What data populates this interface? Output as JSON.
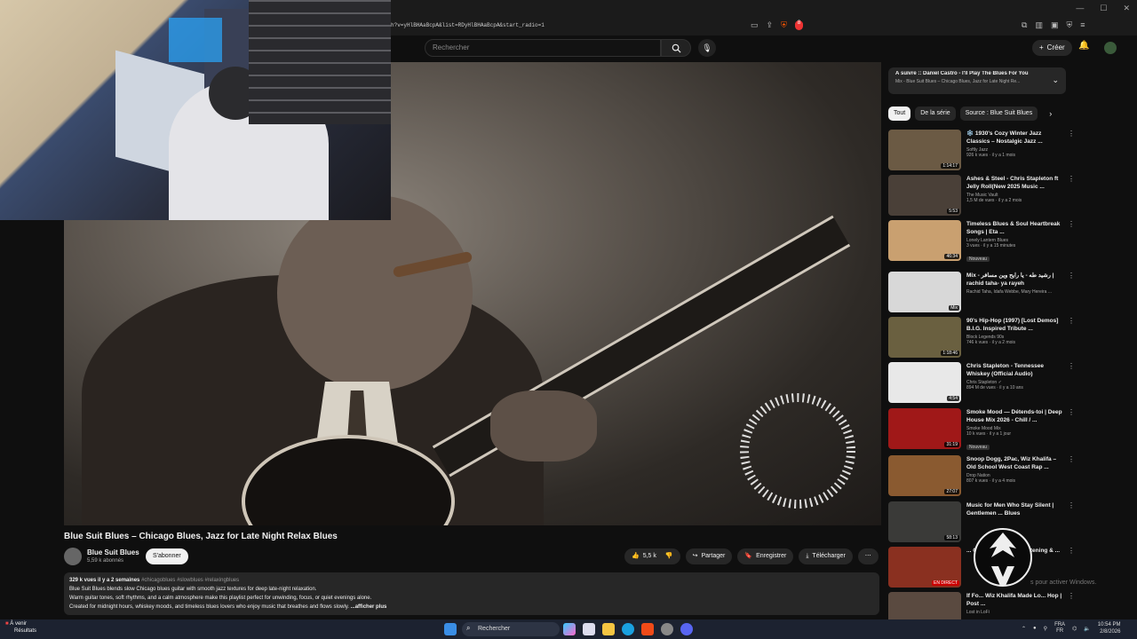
{
  "browser": {
    "url": "h?v=yHlBHAaBcpA&list=RDyHlBHAaBcpA&start_radio=1",
    "notif_count": "8"
  },
  "header": {
    "search_placeholder": "Rechercher",
    "create_label": "Créer",
    "bell_count": "9+"
  },
  "video": {
    "title": "Blue Suit Blues – Chicago Blues, Jazz for Late Night Relax Blues",
    "channel": "Blue Suit Blues",
    "subscribers": "5,59 k abonnés",
    "subscribe_label": "S'abonner",
    "likes": "5,5 k",
    "share_label": "Partager",
    "save_label": "Enregistrer",
    "download_label": "Télécharger"
  },
  "description": {
    "meta": "329 k vues  il y a 2 semaines",
    "tags": "#chicagoblues #slowblues #relaxingblues",
    "line1": "Blue Suit Blues blends slow Chicago blues guitar with smooth jazz textures for deep late-night relaxation.",
    "line2": "Warm guitar tones, soft rhythms, and a calm atmosphere make this playlist perfect for unwinding, focus, or quiet evenings alone.",
    "line3": "Created for midnight hours, whiskey moods, and timeless blues lovers who enjoy music that breathes and flows slowly.",
    "more": "...afficher plus"
  },
  "upnext": {
    "title": "À suivre :: Daniel Castro - I'll Play The Blues For You",
    "subtitle": "Mix - Blue Suit Blues – Chicago Blues, Jazz for Late Night Re..."
  },
  "chips": [
    "Tout",
    "De la série",
    "Source : Blue Suit Blues"
  ],
  "recommendations": [
    {
      "title": "❄️ 1930's Cozy Winter Jazz Classics – Nostalgic Jazz ...",
      "channel": "Softly Jazz",
      "meta": "926 k vues · il y a 1 mois",
      "duration": "1:14:17",
      "badge": "",
      "color": "#6b5a44"
    },
    {
      "title": "Ashes & Steel - Chris Stapleton ft Jelly Roll(New 2025 Music ...",
      "channel": "The Music Vault",
      "meta": "1,5 M de vues · il y a 2 mois",
      "duration": "5:53",
      "badge": "",
      "color": "#4a4038"
    },
    {
      "title": "Timeless Blues & Soul Heartbreak Songs | Eta ...",
      "channel": "Lonely Lantern Blues",
      "meta": "3 vues · il y a 15 minutes",
      "duration": "46:34",
      "badge": "Nouveau",
      "color": "#c9a070"
    },
    {
      "title": "Mix - رشيد طه - يا رايح وين مسافر | rachid taha- ya rayeh",
      "channel": "Rachid Taha, Idafa Webbe, Mary Hereira ...",
      "meta": "",
      "duration": "Mix",
      "badge": "",
      "color": "#d8d8d8"
    },
    {
      "title": "90's Hip-Hop (1997) [Lost Demos] B.I.G. Inspired Tribute ...",
      "channel": "Block Legends 90s",
      "meta": "746 k vues · il y a 2 mois",
      "duration": "1:18:46",
      "badge": "",
      "color": "#6a6040"
    },
    {
      "title": "Chris Stapleton - Tennessee Whiskey (Official Audio)",
      "channel": "Chris Stapleton ✓",
      "meta": "894 M de vues · il y a 10 ans",
      "duration": "4:54",
      "badge": "",
      "color": "#e8e8e8"
    },
    {
      "title": "Smoke Mood — Détends-toi | Deep House Mix 2026 - Chill / ...",
      "channel": "Smoke Mood Mix",
      "meta": "10 k vues · il y a 1 jour",
      "duration": "31:19",
      "badge": "Nouveau",
      "color": "#a01818"
    },
    {
      "title": "Snoop Dogg, 2Pac, Wiz Khalifa – Old School West Coast Rap ...",
      "channel": "Drop Nation",
      "meta": "807 k vues · il y a 4 mois",
      "duration": "27:07",
      "badge": "",
      "color": "#8a5a30"
    },
    {
      "title": "Music for Men Who Stay Silent | Gentlemen ... Blues",
      "channel": "",
      "meta": "",
      "duration": "58:13",
      "badge": "",
      "color": "#3a3a38"
    },
    {
      "title": "... Café Radio | Soul Listening & ...",
      "channel": "",
      "meta": "",
      "duration": "EN DIRECT",
      "badge": "",
      "color": "#8a3020"
    },
    {
      "title": "If Fo... Wiz Khalifa Made Lo... Hop | Post ...",
      "channel": "Lost in LoFi",
      "meta": "",
      "duration": "",
      "badge": "",
      "color": "#5a4a40"
    }
  ],
  "taskbar": {
    "weather_line1": "À venir",
    "weather_line2": "Résultats",
    "search": "Rechercher",
    "lang1": "FRA",
    "lang2": "FR",
    "time": "10:54 PM",
    "date": "2/8/2026"
  },
  "watermark": {
    "activate": "Activer Windows",
    "activate2": "s pour activer Windows."
  },
  "colors": {
    "background": "#0f0f0f",
    "surface": "#272727",
    "accent_red": "#ff0033"
  }
}
